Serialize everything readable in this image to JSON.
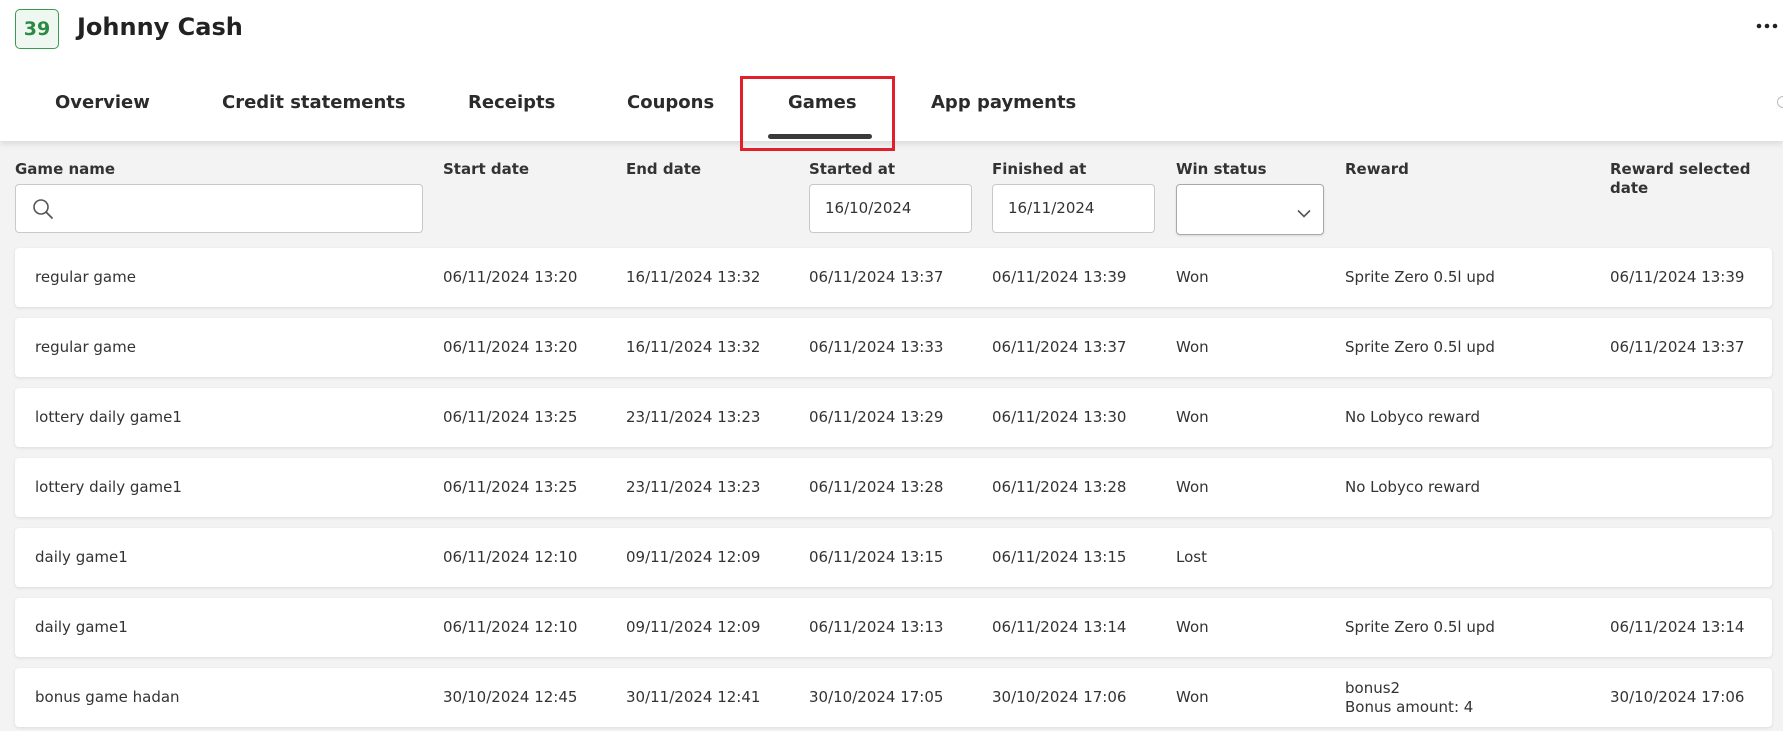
{
  "header": {
    "avatar_text": "39",
    "user_name": "Johnny Cash",
    "more_icon": "more-dots-icon"
  },
  "tabs": [
    {
      "label": "Overview",
      "active": false
    },
    {
      "label": "Credit statements",
      "active": false
    },
    {
      "label": "Receipts",
      "active": false
    },
    {
      "label": "Coupons",
      "active": false
    },
    {
      "label": "Games",
      "active": true
    },
    {
      "label": "App payments",
      "active": false
    }
  ],
  "table": {
    "columns": {
      "game_name": "Game name",
      "start_date": "Start date",
      "end_date": "End date",
      "started_at": "Started at",
      "finished_at": "Finished at",
      "win_status": "Win status",
      "reward": "Reward",
      "reward_selected_date": "Reward selected date"
    },
    "filters": {
      "search_icon": "search-icon",
      "game_name_value": "",
      "started_at": "16/10/2024",
      "finished_at": "16/11/2024",
      "win_status": ""
    },
    "rows": [
      {
        "game_name": "regular game",
        "start_date": "06/11/2024 13:20",
        "end_date": "16/11/2024 13:32",
        "started_at": "06/11/2024 13:37",
        "finished_at": "06/11/2024 13:39",
        "win_status": "Won",
        "reward": "Sprite Zero 0.5l upd",
        "reward_line2": "",
        "reward_selected_date": "06/11/2024 13:39"
      },
      {
        "game_name": "regular game",
        "start_date": "06/11/2024 13:20",
        "end_date": "16/11/2024 13:32",
        "started_at": "06/11/2024 13:33",
        "finished_at": "06/11/2024 13:37",
        "win_status": "Won",
        "reward": "Sprite Zero 0.5l upd",
        "reward_line2": "",
        "reward_selected_date": "06/11/2024 13:37"
      },
      {
        "game_name": "lottery daily game1",
        "start_date": "06/11/2024 13:25",
        "end_date": "23/11/2024 13:23",
        "started_at": "06/11/2024 13:29",
        "finished_at": "06/11/2024 13:30",
        "win_status": "Won",
        "reward": "No Lobyco reward",
        "reward_line2": "",
        "reward_selected_date": ""
      },
      {
        "game_name": "lottery daily game1",
        "start_date": "06/11/2024 13:25",
        "end_date": "23/11/2024 13:23",
        "started_at": "06/11/2024 13:28",
        "finished_at": "06/11/2024 13:28",
        "win_status": "Won",
        "reward": "No Lobyco reward",
        "reward_line2": "",
        "reward_selected_date": ""
      },
      {
        "game_name": "daily game1",
        "start_date": "06/11/2024 12:10",
        "end_date": "09/11/2024 12:09",
        "started_at": "06/11/2024 13:15",
        "finished_at": "06/11/2024 13:15",
        "win_status": "Lost",
        "reward": "",
        "reward_line2": "",
        "reward_selected_date": ""
      },
      {
        "game_name": "daily game1",
        "start_date": "06/11/2024 12:10",
        "end_date": "09/11/2024 12:09",
        "started_at": "06/11/2024 13:13",
        "finished_at": "06/11/2024 13:14",
        "win_status": "Won",
        "reward": "Sprite Zero 0.5l upd",
        "reward_line2": "",
        "reward_selected_date": "06/11/2024 13:14"
      },
      {
        "game_name": "bonus game hadan",
        "start_date": "30/10/2024 12:45",
        "end_date": "30/11/2024 12:41",
        "started_at": "30/10/2024 17:05",
        "finished_at": "30/10/2024 17:06",
        "win_status": "Won",
        "reward": "bonus2",
        "reward_line2": "Bonus amount: 4",
        "reward_selected_date": "30/10/2024 17:06"
      }
    ]
  },
  "colors": {
    "avatar_green": "#2d8a46",
    "highlight_red": "#e0202a",
    "background_gray": "#f3f3f3"
  }
}
